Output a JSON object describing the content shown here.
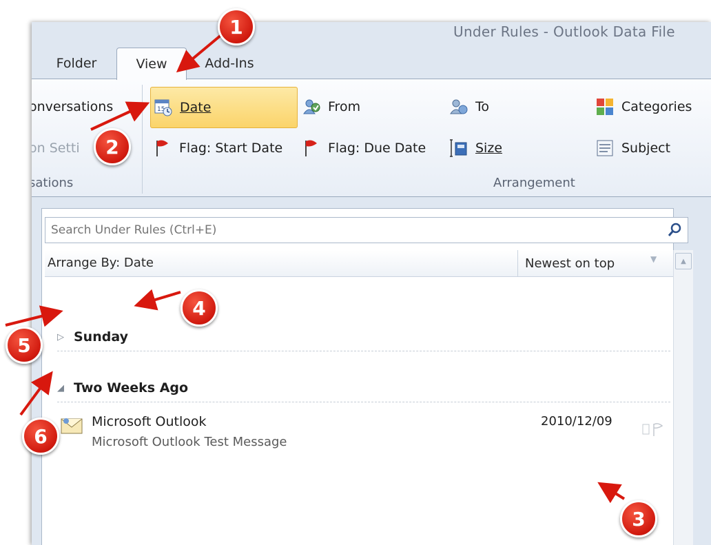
{
  "window": {
    "title": "Under Rules - Outlook Data File"
  },
  "tabs": [
    {
      "label": "Folder"
    },
    {
      "label": "View",
      "active": true
    },
    {
      "label": "Add-Ins"
    }
  ],
  "ribbon": {
    "left_group": {
      "item_conversations": "onversations",
      "item_settings": "on Setti",
      "label": "sations"
    },
    "arrangement": {
      "label": "Arrangement",
      "items": {
        "date": {
          "label": "Date",
          "selected": true
        },
        "from": {
          "label": "From"
        },
        "to": {
          "label": "To"
        },
        "categories": {
          "label": "Categories"
        },
        "flag_start": {
          "label": "Flag: Start Date"
        },
        "flag_due": {
          "label": "Flag: Due Date"
        },
        "size": {
          "label": "Size"
        },
        "subject": {
          "label": "Subject"
        }
      }
    }
  },
  "search": {
    "placeholder": "Search Under Rules (Ctrl+E)"
  },
  "list": {
    "arrange_by": "Arrange By: Date",
    "order": "Newest on top",
    "groups": [
      {
        "title": "Sunday",
        "expanded": false
      },
      {
        "title": "Two Weeks Ago",
        "expanded": true
      }
    ],
    "messages": [
      {
        "sender": "Microsoft Outlook",
        "subject": "Microsoft Outlook Test Message",
        "date": "2010/12/09"
      }
    ]
  },
  "callouts": [
    "1",
    "2",
    "3",
    "4",
    "5",
    "6"
  ],
  "colors": {
    "callout_red": "#d11a0f",
    "selected_button": "#fbd46a",
    "ribbon_bg": "#e8eef6"
  }
}
